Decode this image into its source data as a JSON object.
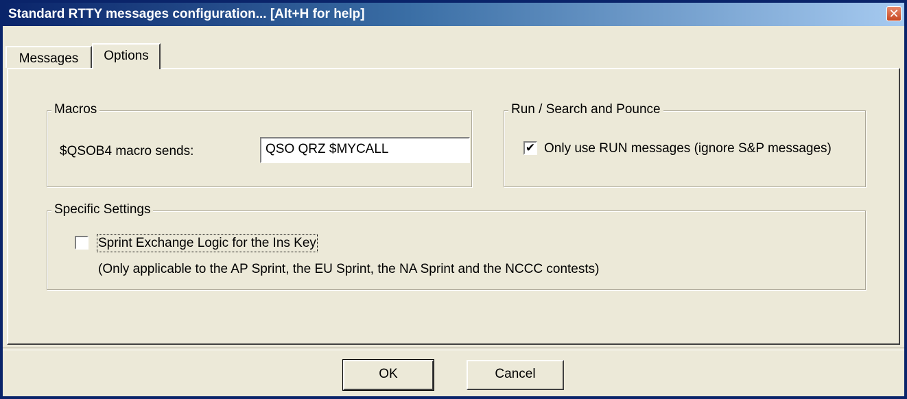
{
  "window": {
    "title": "Standard RTTY messages configuration... [Alt+H for help]",
    "close_symbol": "✕"
  },
  "tabs": [
    {
      "label": "Messages",
      "active": false
    },
    {
      "label": "Options",
      "active": true
    }
  ],
  "macros": {
    "legend": "Macros",
    "label": "$QSOB4 macro sends:",
    "value": "QSO QRZ $MYCALL"
  },
  "run_sp": {
    "legend": "Run / Search and Pounce",
    "checkbox_label": "Only use RUN messages (ignore S&P messages)",
    "checked": true
  },
  "specific": {
    "legend": "Specific Settings",
    "checkbox_label": "Sprint Exchange Logic for the Ins Key",
    "checked": false,
    "note": "(Only applicable to the AP Sprint, the EU Sprint, the NA Sprint and the NCCC contests)"
  },
  "buttons": {
    "ok": "OK",
    "cancel": "Cancel"
  },
  "check_mark": "✔"
}
